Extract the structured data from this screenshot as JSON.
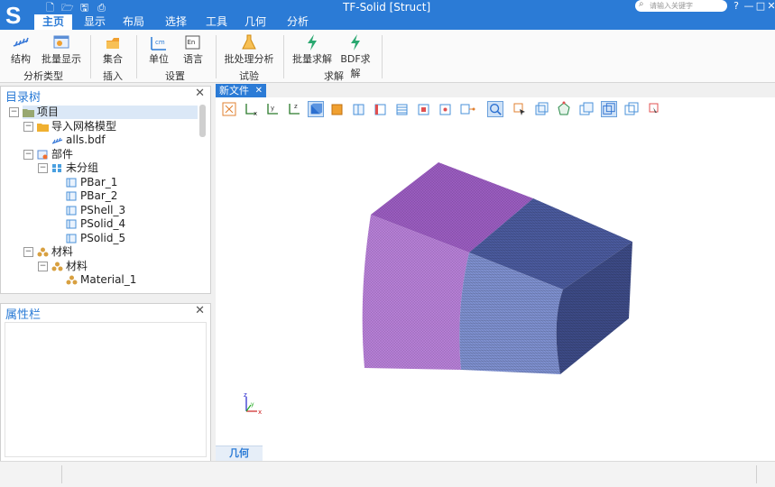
{
  "app": {
    "title": "TF-Solid [Struct]",
    "logo": "S",
    "search_placeholder": "请输入关键字"
  },
  "quick_access": [
    "new-file-icon",
    "open-folder-icon",
    "save-icon",
    "print-icon"
  ],
  "window_controls": {
    "minimize": "—",
    "maximize": "□",
    "close": "✕",
    "help": "?"
  },
  "menu_tabs": [
    "主页",
    "显示",
    "布局",
    "选择",
    "工具",
    "几何",
    "分析"
  ],
  "ribbon": {
    "groups": [
      {
        "label": "分析类型",
        "buttons": [
          "结构",
          "批量显示"
        ]
      },
      {
        "label": "插入",
        "buttons": [
          "集合"
        ]
      },
      {
        "label": "设置",
        "buttons": [
          "单位",
          "语言"
        ]
      },
      {
        "label": "试验",
        "buttons": [
          "批处理分析"
        ]
      },
      {
        "label": "求解",
        "buttons": [
          "批量求解",
          "BDF求解"
        ]
      }
    ],
    "unit_icon_text": "cm",
    "lang_icon_text": "En"
  },
  "tree_panel": {
    "title": "目录树",
    "items": [
      {
        "label": "项目",
        "icon": "folder-icon"
      },
      {
        "label": "导入网格模型",
        "icon": "import-folder-icon"
      },
      {
        "label": "alls.bdf",
        "icon": "mesh-file-icon"
      },
      {
        "label": "部件",
        "icon": "parts-icon"
      },
      {
        "label": "未分组",
        "icon": "group-icon"
      },
      {
        "label": "PBar_1",
        "icon": "property-icon"
      },
      {
        "label": "PBar_2",
        "icon": "property-icon"
      },
      {
        "label": "PShell_3",
        "icon": "property-icon"
      },
      {
        "label": "PSolid_4",
        "icon": "property-icon"
      },
      {
        "label": "PSolid_5",
        "icon": "property-icon"
      },
      {
        "label": "材料",
        "icon": "material-icon"
      },
      {
        "label": "材料",
        "icon": "material-icon"
      },
      {
        "label": "Material_1",
        "icon": "material-icon"
      }
    ]
  },
  "property_panel": {
    "title": "属性栏"
  },
  "viewport": {
    "tab_label": "新文件",
    "bottom_tab": "几何",
    "axis_labels": {
      "x": "x",
      "y": "y",
      "z": "z"
    },
    "toolbar_labels": {
      "x": "x",
      "y": "y",
      "z": "z"
    },
    "colors": {
      "purple": "#a05fc4",
      "blue": "#5b6fb7",
      "accent": "#2b7bd6"
    }
  }
}
